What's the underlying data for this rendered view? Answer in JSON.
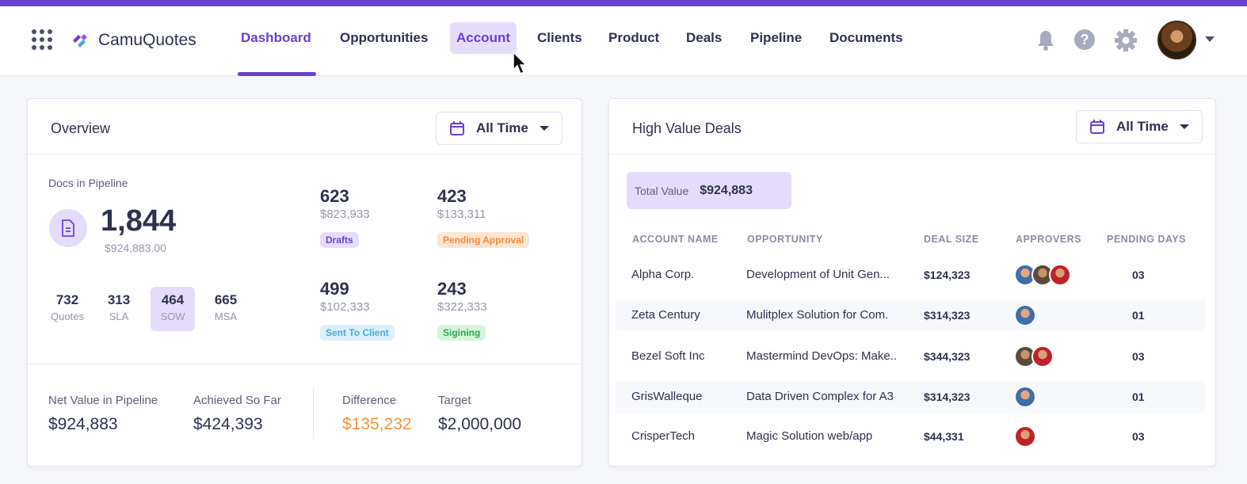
{
  "app": {
    "name": "CamuQuotes"
  },
  "nav": {
    "tabs": [
      "Dashboard",
      "Opportunities",
      "Account",
      "Clients",
      "Product",
      "Deals",
      "Pipeline",
      "Documents"
    ],
    "active_tab": "Dashboard",
    "hovered_tab": "Account",
    "icons": [
      "bell-icon",
      "help-icon",
      "gear-icon"
    ]
  },
  "overview": {
    "title": "Overview",
    "range": "All Time",
    "docs_label": "Docs in Pipeline",
    "docs_total": "1,844",
    "docs_amount": "$924,883.00",
    "doc_types": [
      {
        "count": "732",
        "name": "Quotes"
      },
      {
        "count": "313",
        "name": "SLA"
      },
      {
        "count": "464",
        "name": "SOW"
      },
      {
        "count": "665",
        "name": "MSA"
      }
    ],
    "selected_doc_type": "SOW",
    "stats": [
      {
        "count": "623",
        "amount": "$823,933",
        "status": "Drafts",
        "color": "#6b3fd0",
        "bg": "#e5dcfb"
      },
      {
        "count": "423",
        "amount": "$133,311",
        "status": "Pending Approval",
        "color": "#f08a3c",
        "bg": "#fde4d3"
      },
      {
        "count": "499",
        "amount": "$102,333",
        "status": "Sent To Client",
        "color": "#4aa8dc",
        "bg": "#dcf0fb"
      },
      {
        "count": "243",
        "amount": "$322,333",
        "status": "Sigining",
        "color": "#2fa84f",
        "bg": "#d6f5dd"
      }
    ],
    "metrics": [
      {
        "label": "Net Value in Pipeline",
        "value": "$924,883"
      },
      {
        "label": "Achieved So Far",
        "value": "$424,393"
      },
      {
        "label": "Difference",
        "value": "$135,232",
        "color": "#f5923e"
      },
      {
        "label": "Target",
        "value": "$2,000,000"
      }
    ]
  },
  "high_value": {
    "title": "High Value Deals",
    "range": "All Time",
    "total_label": "Total Value",
    "total_value": "$924,883",
    "columns": [
      "ACCOUNT NAME",
      "OPPORTUNITY",
      "DEAL SIZE",
      "APPROVERS",
      "PENDING DAYS"
    ],
    "rows": [
      {
        "account": "Alpha Corp.",
        "opportunity": "Development of Unit Gen...",
        "deal": "$124,323",
        "approvers": 3,
        "days": "03"
      },
      {
        "account": "Zeta Century",
        "opportunity": "Mulitplex Solution for Com.",
        "deal": "$314,323",
        "approvers": 1,
        "days": "01"
      },
      {
        "account": "Bezel Soft Inc",
        "opportunity": "Mastermind DevOps: Make..",
        "deal": "$344,323",
        "approvers": 2,
        "days": "03"
      },
      {
        "account": "GrisWalleque",
        "opportunity": "Data Driven Complex for A3",
        "deal": "$314,323",
        "approvers": 1,
        "days": "01"
      },
      {
        "account": "CrisperTech",
        "opportunity": "Magic Solution web/app",
        "deal": "$44,331",
        "approvers": 1,
        "days": "03"
      }
    ]
  }
}
